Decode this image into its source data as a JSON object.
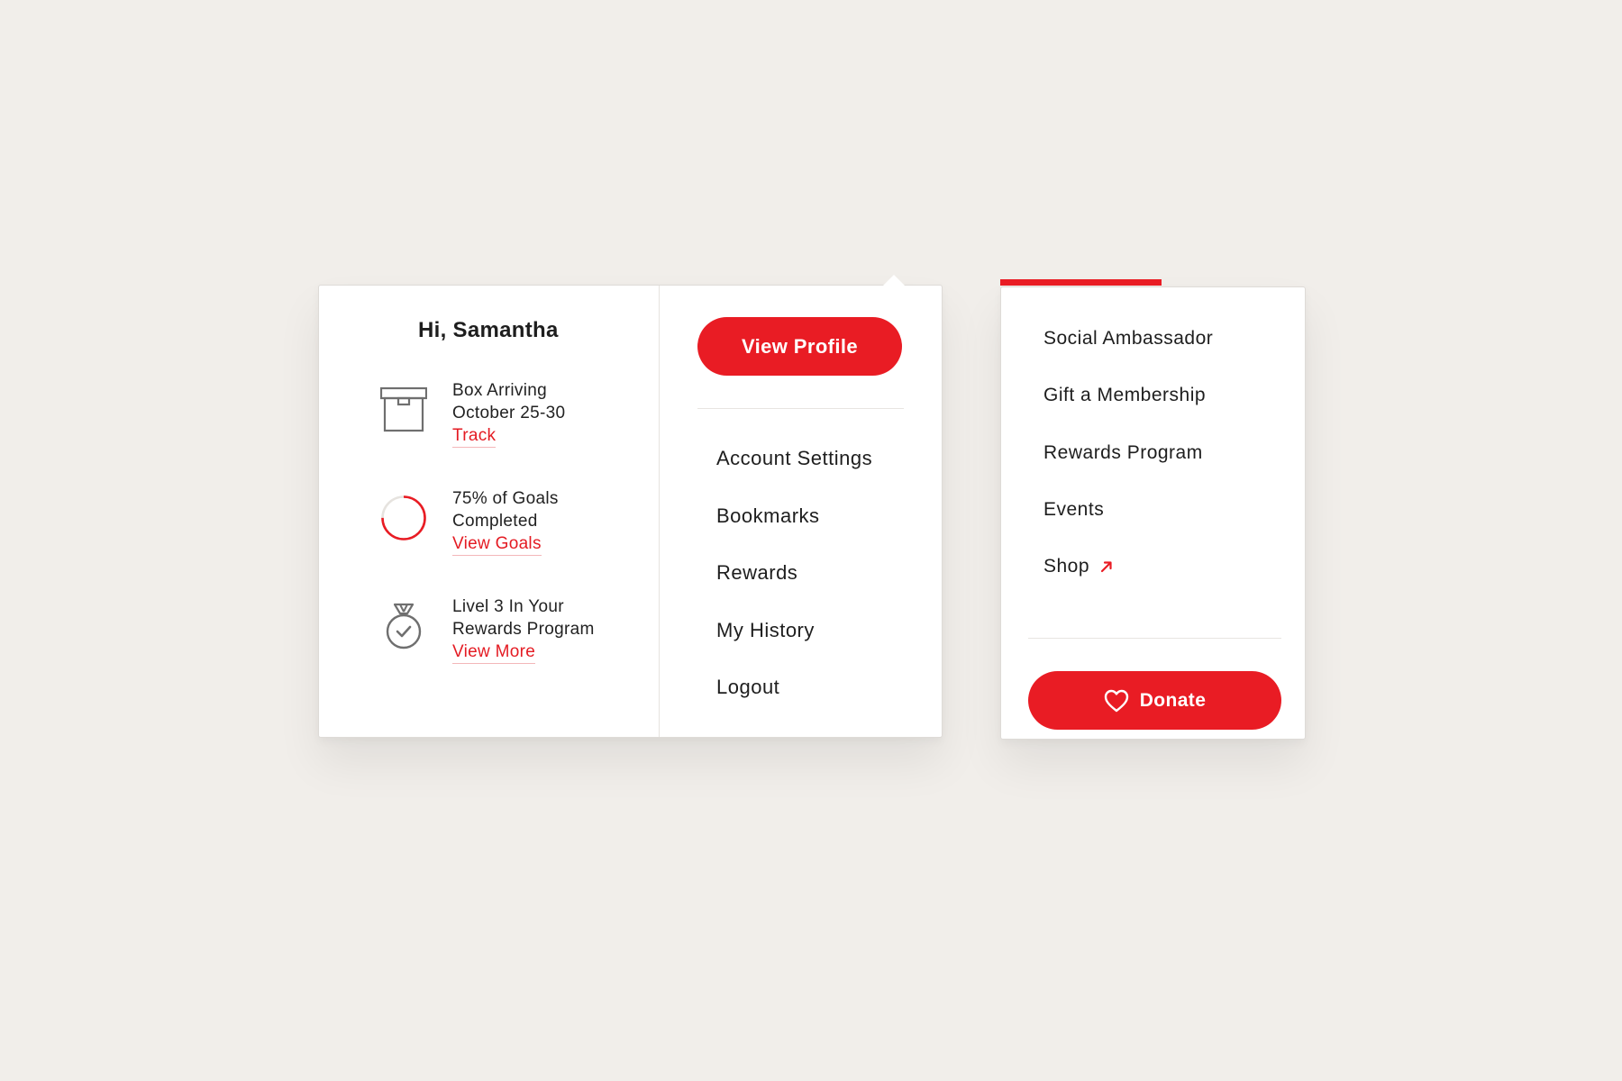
{
  "account_menu": {
    "greeting": "Hi, Samantha",
    "summary": [
      {
        "icon": "box-icon",
        "lines": [
          "Box Arriving",
          "October 25-30"
        ],
        "link": "Track"
      },
      {
        "icon": "progress-ring-icon",
        "lines": [
          "75% of Goals",
          "Completed"
        ],
        "link": "View Goals",
        "progress": 0.75
      },
      {
        "icon": "medal-icon",
        "lines": [
          "Livel 3 In Your",
          "Rewards Program"
        ],
        "link": "View More"
      }
    ],
    "view_profile_label": "View Profile",
    "nav_items": [
      "Account Settings",
      "Bookmarks",
      "Rewards",
      "My History",
      "Logout"
    ]
  },
  "links_menu": {
    "items": [
      "Social Ambassador",
      "Gift a Membership",
      "Rewards Program",
      "Events",
      "Shop"
    ],
    "external_icon": "arrow-up-right-icon",
    "donate_label": "Donate",
    "donate_icon": "heart-icon"
  },
  "colors": {
    "accent": "#e91c24",
    "background": "#f1eeea",
    "panel": "#ffffff",
    "icon_gray": "#6f6f6f"
  }
}
